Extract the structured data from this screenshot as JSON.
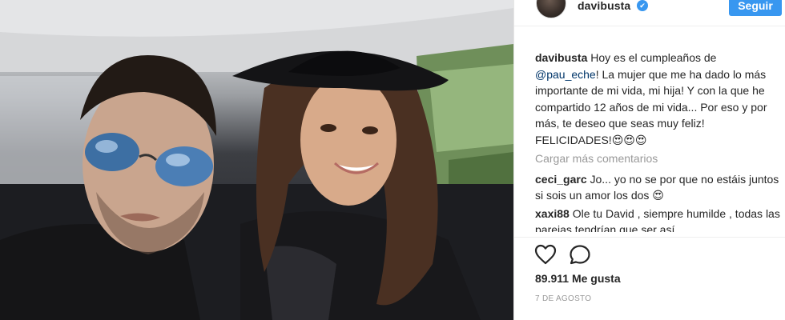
{
  "post": {
    "username": "davibusta",
    "verified_badge": "✔",
    "follow_label": "Seguir",
    "caption": {
      "author": "davibusta",
      "text_before": " Hoy es el cumpleaños de ",
      "mention": "@pau_eche",
      "text_after": "! La mujer que me ha dado lo más importante de mi vida, mi hija! Y con la que he compartido 12 años de mi vida... Por eso y por más, te deseo que seas muy feliz! FELICIDADES!😍😍😍"
    },
    "load_more_label": "Cargar más comentarios",
    "comments": [
      {
        "author": "ceci_garc",
        "text": " Jo... yo no se por que no estáis juntos si sois un amor los dos 😍"
      },
      {
        "author": "xaxi88",
        "text": " Ole tu David , siempre humilde , todas las parejas tendrían que ser así"
      }
    ],
    "likes": "89.911 Me gusta",
    "date": "7 DE AGOSTO",
    "icons": {
      "like": "heart-icon",
      "comment": "comment-icon"
    }
  },
  "colors": {
    "accent": "#3897f0",
    "text": "#262626",
    "muted": "#999999",
    "mention": "#003569"
  }
}
